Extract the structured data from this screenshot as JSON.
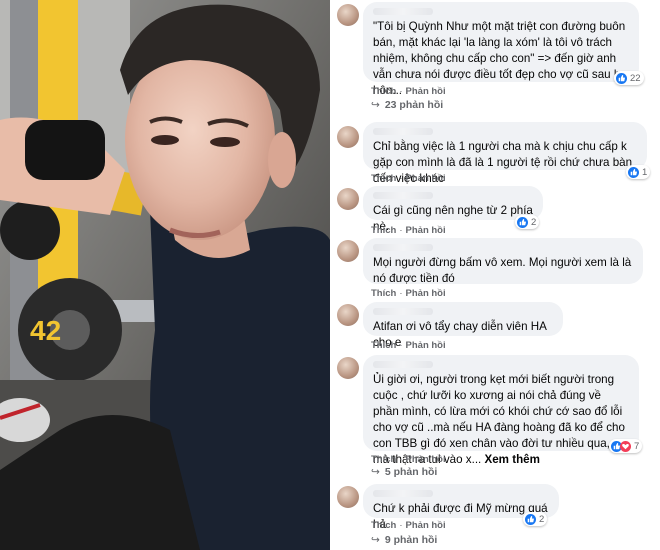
{
  "actions": {
    "like": "Thích",
    "reply": "Phản hồi"
  },
  "comments": [
    {
      "text": "\"Tôi bị Quỳnh Như một mặt triệt con đường buôn bán, mặt khác lại 'la làng la xóm' là tôi vô trách nhiệm, không chu cấp cho con\" => đến giờ anh vẫn chưa nói được điều tốt đẹp cho vợ cũ sau ly hôn...",
      "reactions": "22",
      "replies": "23 phản hồi"
    },
    {
      "text": "Chỉ bằng việc là 1 người cha mà k chịu chu cấp k gặp con mình là đã là 1 người tệ rồi chứ chưa bàn đến việc khác",
      "reactions": "1",
      "replies": ""
    },
    {
      "text": "Cái gì cũng nên nghe từ 2 phía nè.",
      "reactions": "2",
      "replies": ""
    },
    {
      "text": "Mọi người đừng bấm vô xem. Mọi người xem là là nó được tiền đó",
      "reactions": "",
      "replies": ""
    },
    {
      "text": "Atifan ơi vô tẩy chay diễn viên HA cho e",
      "reactions": "",
      "replies": ""
    },
    {
      "text": "Ủi giời ơi, người trong kẹt mới biết người trong cuộc , chứ lưỡi ko xương ai nói chả đúng về phần mình, có lừa mới có khói chứ cớ sao đổ lỗi cho vợ cũ ..mà nếu HA đàng hoàng đã ko để cho con TBB gì đó xen chân vào đời tư nhiều qua, mà thật ra tui vào x...",
      "see_more": "Xem thêm",
      "reactions": "7",
      "replies": "5 phản hồi"
    },
    {
      "text": "Chứ k phải được đi Mỹ mừng quá hả",
      "reactions": "2",
      "replies": "9 phản hồi"
    }
  ]
}
